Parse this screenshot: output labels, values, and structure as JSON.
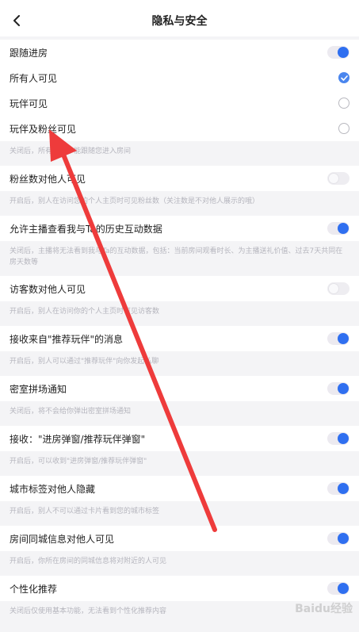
{
  "header": {
    "title": "隐私与安全"
  },
  "section_follow": {
    "label": "跟随进房",
    "options": [
      "所有人可见",
      "玩伴可见",
      "玩伴及粉丝可见"
    ],
    "desc": "关闭后，所有人都不能跟随您进入房间"
  },
  "settings": [
    {
      "label": "粉丝数对他人可见",
      "on": false,
      "desc": "开启后，别人在访问您的个人主页时可见粉丝数（关注数是不对他人展示的哦）"
    },
    {
      "label": "允许主播查看我与Ta的历史互动数据",
      "on": true,
      "desc": "关闭后，主播将无法看到我与Ta的互动数据，包括：当前房间观看时长、为主播送礼价值、过去7天共同在房天数等"
    },
    {
      "label": "访客数对他人可见",
      "on": false,
      "desc": "开启后，别人在访问你的个人主页时可见访客数"
    },
    {
      "label": "接收来自\"推荐玩伴\"的消息",
      "on": true,
      "desc": "开启后，别人可以通过\"推荐玩伴\"向你发起私聊"
    },
    {
      "label": "密室拼场通知",
      "on": true,
      "desc": "关闭后，将不会给你弹出密室拼场通知"
    },
    {
      "label": "接收：\"进房弹窗/推荐玩伴弹窗\"",
      "on": true,
      "desc": "开启后，可以收到\"进房弹窗/推荐玩伴弹窗\""
    },
    {
      "label": "城市标签对他人隐藏",
      "on": true,
      "desc": "开启后，别人不可以通过卡片看到您的城市标签"
    },
    {
      "label": "房间同城信息对他人可见",
      "on": true,
      "desc": "开启后，你所在房间的同城信息将对附近的人可见"
    },
    {
      "label": "个性化推荐",
      "on": true,
      "desc": "关闭后仅使用基本功能，无法看到个性化推荐内容"
    }
  ],
  "icons": {
    "back": "chevron-left-icon",
    "accent": "#2f6ff0"
  },
  "watermark": "Baidu经验"
}
